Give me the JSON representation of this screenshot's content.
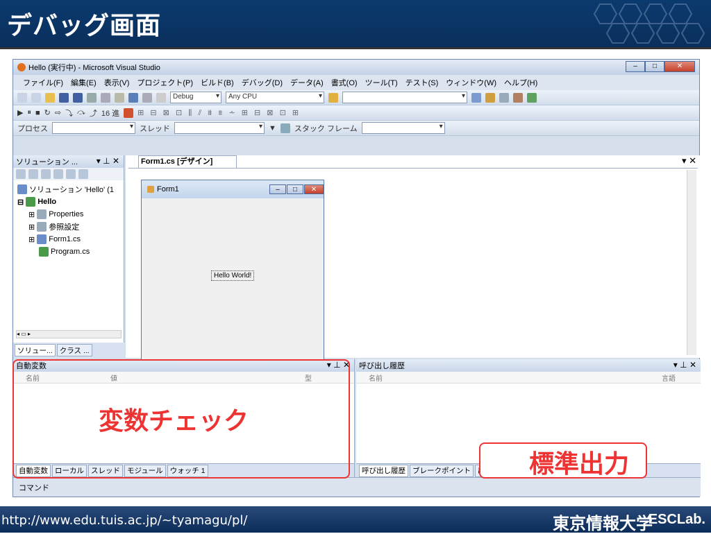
{
  "slide": {
    "title": "デバッグ画面",
    "footer_url": "http://www.edu.tuis.ac.jp/~tyamagu/pl/",
    "footer_org": "東京情報大学",
    "footer_lab": "ESCLab."
  },
  "window": {
    "title": "Hello (実行中) - Microsoft Visual Studio",
    "minimize": "–",
    "maximize": "□",
    "close": "✕"
  },
  "menu": [
    "ファイル(F)",
    "編集(E)",
    "表示(V)",
    "プロジェクト(P)",
    "ビルド(B)",
    "デバッグ(D)",
    "データ(A)",
    "書式(O)",
    "ツール(T)",
    "テスト(S)",
    "ウィンドウ(W)",
    "ヘルプ(H)"
  ],
  "toolbar": {
    "config": "Debug",
    "platform": "Any CPU",
    "font_size": "16 進",
    "process_label": "プロセス",
    "thread_label": "スレッド",
    "stackframe_label": "スタック フレーム"
  },
  "solution": {
    "header": "ソリューション ...",
    "items": [
      "ソリューション 'Hello' (1",
      "Hello",
      "Properties",
      "参照設定",
      "Form1.cs",
      "Program.cs"
    ],
    "tab1": "ソリュー...",
    "tab2": "クラス ..."
  },
  "designer": {
    "tab": "Form1.cs [デザイン]",
    "form_title": "Form1",
    "label": "Hello World!"
  },
  "autos": {
    "header": "自動変数",
    "col_name": "名前",
    "col_value": "値",
    "col_type": "型",
    "tabs": [
      "自動変数",
      "ローカル",
      "スレッド",
      "モジュール",
      "ウォッチ 1"
    ]
  },
  "callstack": {
    "header": "呼び出し履歴",
    "col_name": "名前",
    "col_lang": "言語",
    "tabs": [
      "呼び出し履歴",
      "ブレークポイント",
      "出力"
    ]
  },
  "status": "コマンド",
  "callouts": {
    "variables": "変数チェック",
    "stdout": "標準出力"
  }
}
